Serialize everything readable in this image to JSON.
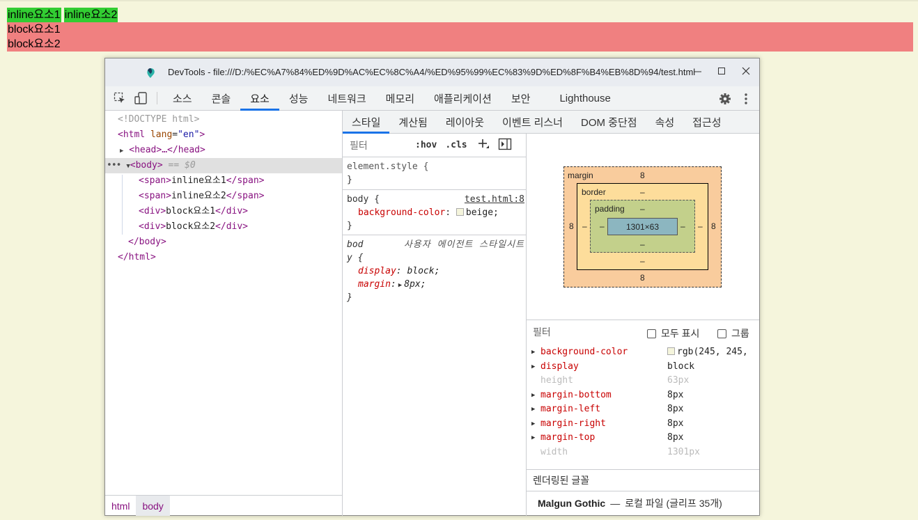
{
  "page": {
    "inline_spans": [
      "inline요소1",
      "inline요소2"
    ],
    "block_divs": [
      "block요소1",
      "block요소2"
    ]
  },
  "devtools": {
    "window_title": "DevTools - file:///D:/%EC%A7%84%ED%9D%AC%EC%8C%A4/%ED%95%99%EC%83%9D%ED%8F%B4%EB%8D%94/test.html",
    "main_tabs": [
      "소스",
      "콘솔",
      "요소",
      "성능",
      "네트워크",
      "메모리",
      "애플리케이션",
      "보안",
      "Lighthouse"
    ],
    "active_main_tab": "요소",
    "elements": {
      "doctype": "<!DOCTYPE html>",
      "html_open_tag": "html",
      "html_attr_name": "lang",
      "html_attr_value": "\"en\"",
      "head_collapsed": "<head>…</head>",
      "body_tag": "body",
      "selected_marker": "== $0",
      "children": [
        {
          "tag": "span",
          "text": "inline요소1"
        },
        {
          "tag": "span",
          "text": "inline요소2"
        },
        {
          "tag": "div",
          "text": "block요소1"
        },
        {
          "tag": "div",
          "text": "block요소2"
        }
      ],
      "body_close": "</body>",
      "html_close": "</html>",
      "breadcrumbs": [
        "html",
        "body"
      ]
    },
    "sub_tabs": [
      "스타일",
      "계산됨",
      "레이아웃",
      "이벤트 리스너",
      "DOM 중단점",
      "속성",
      "접근성"
    ],
    "styles": {
      "filter_placeholder": "필터",
      "hov": ":hov",
      "cls": ".cls",
      "element_style": "element.style {",
      "close_brace": "}",
      "body_selector": "body {",
      "body_source": "test.html:8",
      "bg_prop": "background-color",
      "bg_value": "beige;",
      "ua_selector_1": "bod",
      "ua_source": "사용자 에이전트 스타일시트",
      "ua_selector_2": "y {",
      "display_prop": "display",
      "display_value": "block;",
      "margin_prop": "margin",
      "margin_value": "8px;"
    },
    "box_model": {
      "margin_label": "margin",
      "border_label": "border",
      "padding_label": "padding",
      "margin_top": "8",
      "margin_bottom": "8",
      "margin_left": "8",
      "margin_right": "8",
      "border_top": "–",
      "border_bottom": "–",
      "border_left": "–",
      "border_right": "–",
      "padding_top": "–",
      "padding_bottom": "–",
      "padding_left": "–",
      "padding_right": "–",
      "content": "1301×63"
    },
    "computed": {
      "filter_placeholder": "필터",
      "show_all": "모두 표시",
      "group": "그룹",
      "props": [
        {
          "name": "background-color",
          "value": "rgb(245, 245,",
          "expandable": true,
          "swatch": true
        },
        {
          "name": "display",
          "value": "block",
          "expandable": true
        },
        {
          "name": "height",
          "value": "63px",
          "expandable": false
        },
        {
          "name": "margin-bottom",
          "value": "8px",
          "expandable": true
        },
        {
          "name": "margin-left",
          "value": "8px",
          "expandable": true
        },
        {
          "name": "margin-right",
          "value": "8px",
          "expandable": true
        },
        {
          "name": "margin-top",
          "value": "8px",
          "expandable": true
        },
        {
          "name": "width",
          "value": "1301px",
          "expandable": false
        }
      ],
      "fonts_heading": "렌더링된 글꼴",
      "font_name": "Malgun Gothic",
      "font_dash": "—",
      "font_detail": "로컬 파일 (글리프 35개)"
    }
  },
  "colors": {
    "page_bg": "#f5f5dc",
    "inline_bg": "#32cd32",
    "block_bg": "#f08080",
    "accent": "#1a73e8"
  }
}
